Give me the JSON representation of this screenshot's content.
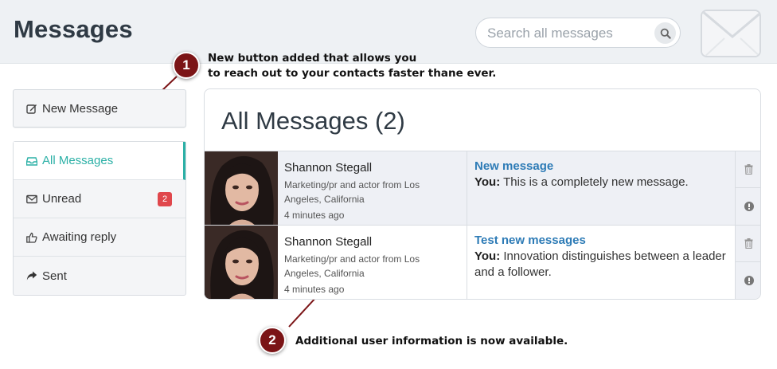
{
  "header": {
    "title": "Messages",
    "search_placeholder": "Search all messages"
  },
  "sidebar": {
    "new_message_label": "New Message",
    "folders": [
      {
        "label": "All Messages",
        "icon": "inbox-icon",
        "active": true
      },
      {
        "label": "Unread",
        "icon": "envelope-icon",
        "badge": "2"
      },
      {
        "label": "Awaiting reply",
        "icon": "thumbs-up-icon"
      },
      {
        "label": "Sent",
        "icon": "share-icon"
      }
    ]
  },
  "inbox": {
    "title": "All Messages (2)",
    "messages": [
      {
        "sender": "Shannon Stegall",
        "bio": "Marketing/pr and actor from Los Angeles, California",
        "time": "4 minutes ago",
        "subject": "New message",
        "prefix": "You:",
        "body": "This is a completely new message.",
        "unread": true
      },
      {
        "sender": "Shannon Stegall",
        "bio": "Marketing/pr and actor from Los Angeles, California",
        "time": "4 minutes ago",
        "subject": "Test new messages",
        "prefix": "You:",
        "body": "Innovation distinguishes between a leader and a follower.",
        "unread": false
      }
    ]
  },
  "callouts": [
    {
      "number": "1",
      "text_line1": "New button added that allows you",
      "text_line2": "to reach out to your contacts faster thane ever."
    },
    {
      "number": "2",
      "text_line1": "Additional user information is now available."
    }
  ],
  "colors": {
    "accent": "#2bb0a6",
    "link": "#2d7bb6",
    "badge": "#e0474c",
    "callout": "#7b1416"
  }
}
